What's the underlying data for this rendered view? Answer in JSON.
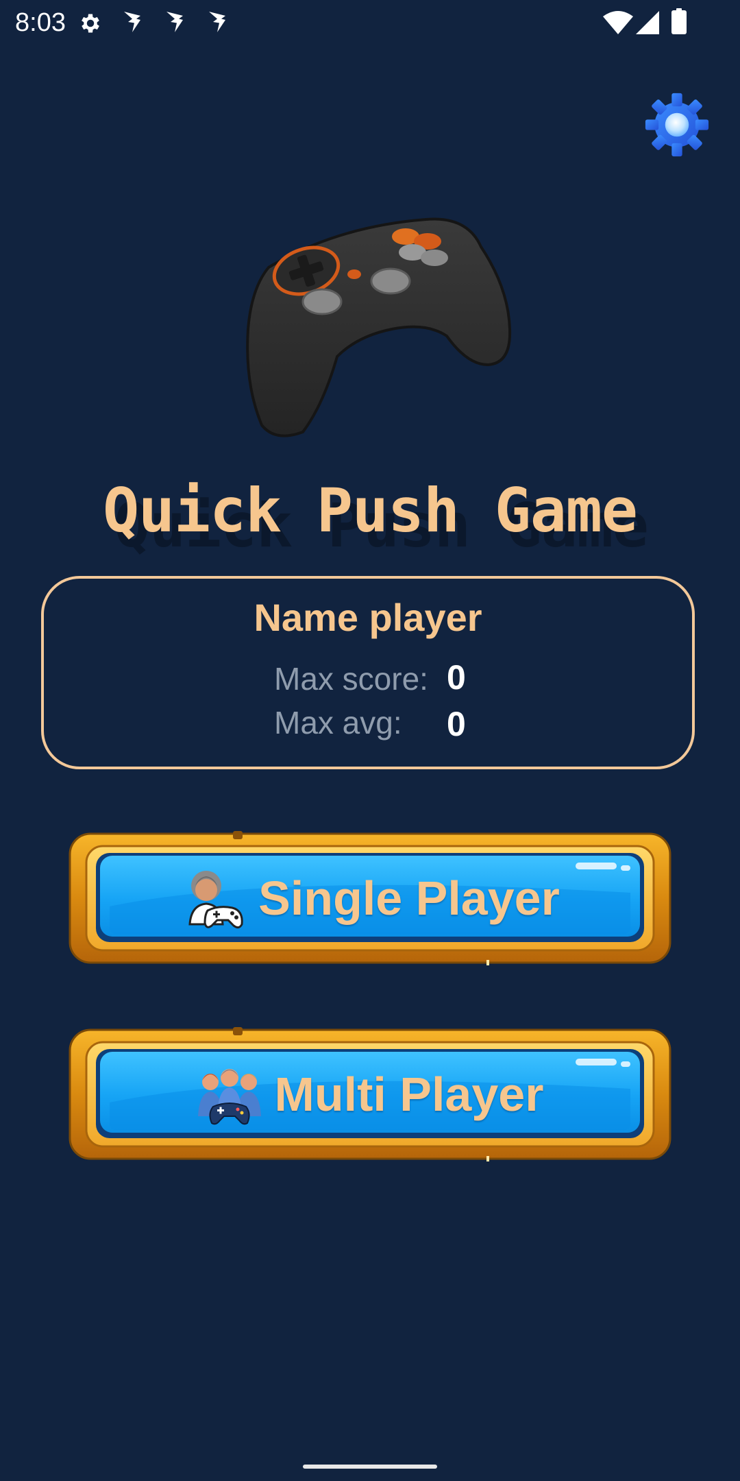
{
  "status_bar": {
    "time": "8:03",
    "icons": [
      "settings-icon",
      "notification-icon",
      "notification-icon",
      "notification-icon",
      "wifi-icon",
      "signal-icon",
      "battery-icon"
    ]
  },
  "settings": {
    "icon": "gear-icon",
    "color": "#2f6ef0"
  },
  "app": {
    "title": "Quick Push Game",
    "title_color": "#f6c68e",
    "background": "#11233f"
  },
  "player_card": {
    "name": "Name player",
    "stats": [
      {
        "label": "Max score:",
        "value": "0"
      },
      {
        "label": "Max avg:",
        "value": "0"
      }
    ]
  },
  "buttons": {
    "single": {
      "label": "Single Player",
      "icon": "player-with-controller-icon"
    },
    "multi": {
      "label": "Multi Player",
      "icon": "group-with-controller-icon"
    }
  }
}
